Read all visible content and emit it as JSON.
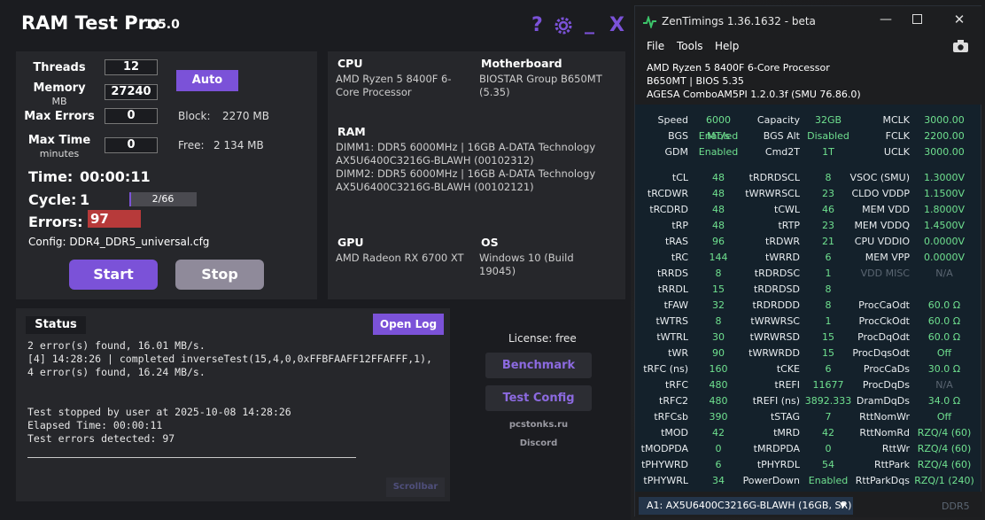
{
  "rtp": {
    "title": "RAM Test Pro",
    "version": "1.5.0",
    "icons": {
      "help": "?",
      "gear": "gear-icon",
      "min": "_",
      "close": "X"
    },
    "threads_label": "Threads",
    "threads_value": "12",
    "memory_label": "Memory",
    "memory_sub": "MB",
    "memory_value": "27240",
    "auto_label": "Auto",
    "max_errors_label": "Max Errors",
    "max_errors_value": "0",
    "block_label": "Block:",
    "block_value": "2270 MB",
    "max_time_label": "Max Time",
    "max_time_sub": "minutes",
    "max_time_value": "0",
    "free_label": "Free:",
    "free_value": "2 134 MB",
    "time_label": "Time:",
    "time_value": "00:00:11",
    "cycle_label": "Cycle:",
    "cycle_value": "1",
    "cycle_progress": "2/66",
    "cycle_fraction": 0.0303,
    "errors_label": "Errors:",
    "errors_value": "97",
    "config_label": "Config: DDR4_DDR5_universal.cfg",
    "start_label": "Start",
    "stop_label": "Stop",
    "cpu_head": "CPU",
    "cpu_value": "AMD Ryzen 5 8400F 6-Core Processor",
    "mb_head": "Motherboard",
    "mb_value": "BIOSTAR Group B650MT (5.35)",
    "ram_head": "RAM",
    "dimm1": "DIMM1: DDR5 6000MHz | 16GB A-DATA Technology AX5U6400C3216G-BLAWH (00102312)",
    "dimm2": "DIMM2: DDR5 6000MHz | 16GB A-DATA Technology AX5U6400C3216G-BLAWH (00102121)",
    "gpu_head": "GPU",
    "gpu_value": "AMD Radeon RX 6700 XT",
    "os_head": "OS",
    "os_value": "Windows 10 (Build 19045)",
    "status_head": "Status",
    "open_log": "Open Log",
    "log_lines": [
      "2 error(s) found, 16.01 MB/s.",
      "[4] 14:28:26 | completed inverseTest(15,4,0,0xFFBFAAFF12FFAFFF,1),",
      "4 error(s) found, 16.24 MB/s.",
      "",
      "",
      "Test stopped by user at 2025-10-08 14:28:26",
      "Elapsed Time: 00:00:11",
      "Test errors detected: 97"
    ],
    "scrollbar": "Scrollbar",
    "license": "License: free",
    "benchmark": "Benchmark",
    "test_config": "Test Config",
    "site": "pcstonks.ru",
    "discord": "Discord"
  },
  "zt": {
    "title": "ZenTimings 1.36.1632 - beta",
    "menu": [
      "File",
      "Tools",
      "Help"
    ],
    "cpu": "AMD Ryzen 5 8400F 6-Core Processor",
    "board": "B650MT | BIOS 5.35",
    "agesa": "AGESA ComboAM5PI 1.2.0.3f (SMU 76.86.0)",
    "rows": [
      [
        "Speed",
        "6000 MT/s",
        "Capacity",
        "32GB",
        "MCLK",
        "3000.00"
      ],
      [
        "BGS",
        "Enabled",
        "BGS Alt",
        "Disabled",
        "FCLK",
        "2200.00"
      ],
      [
        "GDM",
        "Enabled",
        "Cmd2T",
        "1T",
        "UCLK",
        "3000.00"
      ],
      [
        "tCL",
        "48",
        "tRDRDSCL",
        "8",
        "VSOC (SMU)",
        "1.3000V"
      ],
      [
        "tRCDWR",
        "48",
        "tWRWRSCL",
        "23",
        "CLDO VDDP",
        "1.1500V"
      ],
      [
        "tRCDRD",
        "48",
        "tCWL",
        "46",
        "MEM VDD",
        "1.8000V"
      ],
      [
        "tRP",
        "48",
        "tRTP",
        "23",
        "MEM VDDQ",
        "1.4500V"
      ],
      [
        "tRAS",
        "96",
        "tRDWR",
        "21",
        "CPU VDDIO",
        "0.0000V"
      ],
      [
        "tRC",
        "144",
        "tWRRD",
        "6",
        "MEM VPP",
        "0.0000V"
      ],
      [
        "tRRDS",
        "8",
        "tRDRDSC",
        "1",
        "VDD MISC",
        "N/A"
      ],
      [
        "tRRDL",
        "15",
        "tRDRDSD",
        "8",
        "",
        ""
      ],
      [
        "tFAW",
        "32",
        "tRDRDDD",
        "8",
        "ProcCaOdt",
        "60.0 Ω"
      ],
      [
        "tWTRS",
        "8",
        "tWRWRSC",
        "1",
        "ProcCkOdt",
        "60.0 Ω"
      ],
      [
        "tWTRL",
        "30",
        "tWRWRSD",
        "15",
        "ProcDqOdt",
        "60.0 Ω"
      ],
      [
        "tWR",
        "90",
        "tWRWRDD",
        "15",
        "ProcDqsOdt",
        "Off"
      ],
      [
        "tRFC (ns)",
        "160",
        "tCKE",
        "6",
        "ProcCaDs",
        "30.0 Ω"
      ],
      [
        "tRFC",
        "480",
        "tREFI",
        "11677",
        "ProcDqDs",
        "N/A"
      ],
      [
        "tRFC2",
        "480",
        "tREFI (ns)",
        "3892.333",
        "DramDqDs",
        "34.0 Ω"
      ],
      [
        "tRFCsb",
        "390",
        "tSTAG",
        "7",
        "RttNomWr",
        "Off"
      ],
      [
        "tMOD",
        "42",
        "tMRD",
        "42",
        "RttNomRd",
        "RZQ/4 (60)"
      ],
      [
        "tMODPDA",
        "0",
        "tMRDPDA",
        "0",
        "RttWr",
        "RZQ/4 (60)"
      ],
      [
        "tPHYWRD",
        "6",
        "tPHYRDL",
        "54",
        "RttPark",
        "RZQ/4 (60)"
      ],
      [
        "tPHYWRL",
        "34",
        "PowerDown",
        "Enabled",
        "RttParkDqs",
        "RZQ/1 (240)"
      ]
    ],
    "module": "A1: AX5U6400C3216G-BLAWH (16GB, SR)",
    "ddr": "DDR5"
  }
}
